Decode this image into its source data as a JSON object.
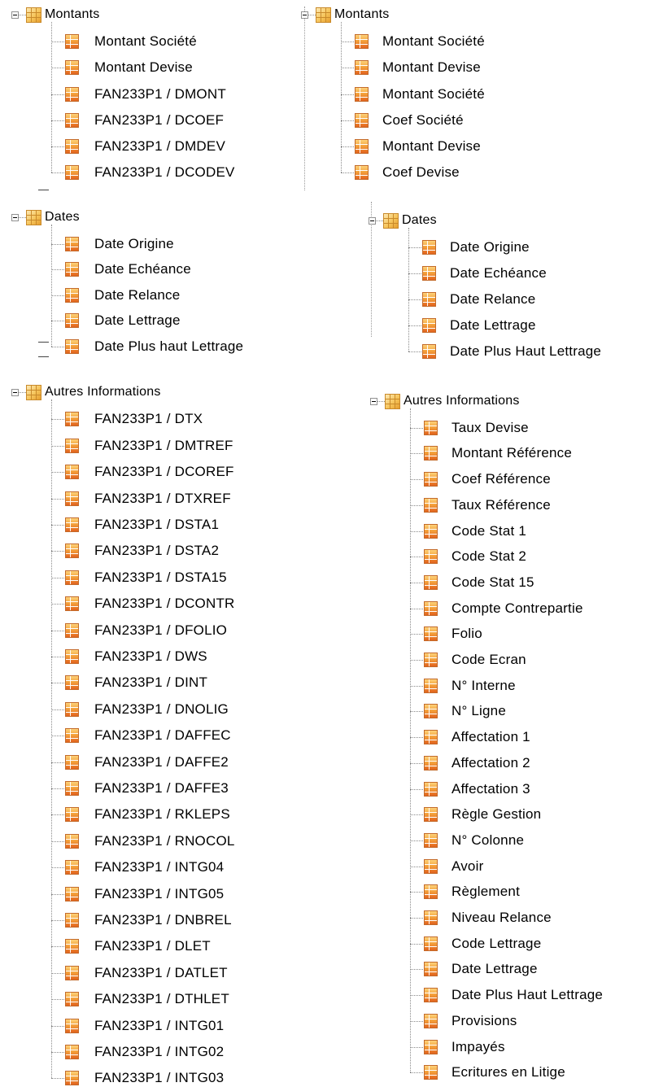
{
  "left": {
    "montants": {
      "title": "Montants",
      "items": [
        "Montant Société",
        "Montant Devise",
        "FAN233P1 / DMONT",
        "FAN233P1 / DCOEF",
        "FAN233P1 / DMDEV",
        "FAN233P1 / DCODEV"
      ]
    },
    "dates": {
      "title": "Dates",
      "items": [
        "Date Origine",
        "Date Echéance",
        "Date Relance",
        "Date Lettrage",
        "Date Plus haut Lettrage"
      ]
    },
    "autres": {
      "title": "Autres Informations",
      "items": [
        "FAN233P1 / DTX",
        "FAN233P1 / DMTREF",
        "FAN233P1 / DCOREF",
        "FAN233P1 / DTXREF",
        "FAN233P1 / DSTA1",
        "FAN233P1 / DSTA2",
        "FAN233P1 / DSTA15",
        "FAN233P1 / DCONTR",
        "FAN233P1 / DFOLIO",
        "FAN233P1 / DWS",
        "FAN233P1 / DINT",
        "FAN233P1 / DNOLIG",
        "FAN233P1 / DAFFEC",
        "FAN233P1 / DAFFE2",
        "FAN233P1 / DAFFE3",
        "FAN233P1 / RKLEPS",
        "FAN233P1 / RNOCOL",
        "FAN233P1 / INTG04",
        "FAN233P1 / INTG05",
        "FAN233P1 / DNBREL",
        "FAN233P1 / DLET",
        "FAN233P1 / DATLET",
        "FAN233P1 / DTHLET",
        "FAN233P1 / INTG01",
        "FAN233P1 / INTG02",
        "FAN233P1 / INTG03"
      ]
    }
  },
  "right": {
    "montants": {
      "title": "Montants",
      "items": [
        "Montant Société",
        "Montant Devise",
        "Montant Société",
        "Coef Société",
        "Montant Devise",
        "Coef Devise"
      ]
    },
    "dates": {
      "title": "Dates",
      "items": [
        "Date Origine",
        "Date Echéance",
        "Date Relance",
        "Date  Lettrage",
        "Date Plus Haut Lettrage"
      ]
    },
    "autres": {
      "title": "Autres Informations",
      "items": [
        "Taux Devise",
        "Montant Référence",
        "Coef Référence",
        "Taux Référence",
        "Code Stat 1",
        "Code Stat 2",
        "Code Stat 15",
        "Compte Contrepartie",
        "Folio",
        "Code Ecran",
        "N° Interne",
        "N° Ligne",
        "Affectation 1",
        "Affectation 2",
        "Affectation 3",
        "Règle Gestion",
        "N° Colonne",
        "Avoir",
        "Règlement",
        "Niveau Relance",
        "Code Lettrage",
        "Date Lettrage",
        "Date Plus Haut Lettrage",
        "Provisions",
        "Impayés",
        "Ecritures en Litige"
      ]
    },
    "icons": {
      "folder": "folder-table-icon",
      "field": "field-table-icon",
      "toggle": "collapse-toggle-icon"
    }
  }
}
